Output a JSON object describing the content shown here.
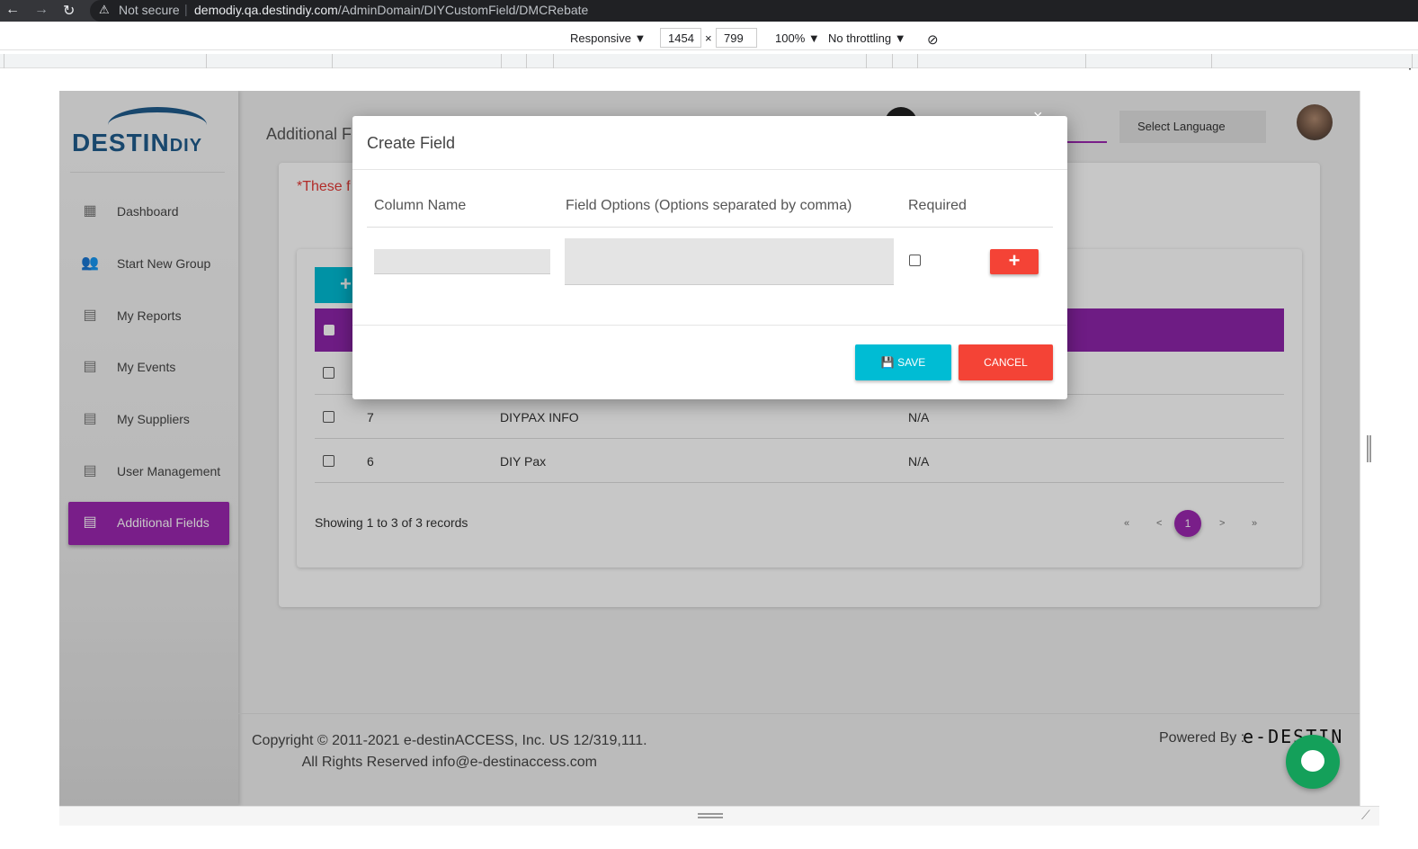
{
  "browser": {
    "not_secure": "Not secure",
    "url_host": "demodiy.qa.destindiy.com",
    "url_path": "/AdminDomain/DIYCustomField/DMCRebate"
  },
  "devtools": {
    "device": "Responsive",
    "width": "1454",
    "times": "×",
    "height": "799",
    "zoom": "100%",
    "throttling": "No throttling"
  },
  "sidebar": {
    "logo_main": "DESTIN",
    "logo_sub": "DIY",
    "items": [
      {
        "label": "Dashboard",
        "icon": "dashboard-icon"
      },
      {
        "label": "Start New Group",
        "icon": "people-icon"
      },
      {
        "label": "My Reports",
        "icon": "list-icon"
      },
      {
        "label": "My Events",
        "icon": "list-icon"
      },
      {
        "label": "My Suppliers",
        "icon": "list-icon"
      },
      {
        "label": "User Management",
        "icon": "list-icon"
      },
      {
        "label": "Additional Fields",
        "icon": "list-icon",
        "active": true
      }
    ]
  },
  "header": {
    "title": "Additional Fi",
    "select_clear": "×",
    "language": "Select Language"
  },
  "card": {
    "note": "*These f",
    "add_label": "+",
    "rows": [
      {
        "id": "",
        "name": "",
        "value": ""
      },
      {
        "id": "7",
        "name": "DIYPAX INFO",
        "value": "N/A"
      },
      {
        "id": "6",
        "name": "DIY Pax",
        "value": "N/A"
      }
    ],
    "showing": "Showing 1 to 3 of 3 records",
    "pager": {
      "first": "«",
      "prev": "<",
      "current": "1",
      "next": ">",
      "last": "»"
    }
  },
  "footer": {
    "copyright_line1": "Copyright © 2011-2021 e-destinACCESS, Inc. US 12/319,111.",
    "copyright_line2": "All Rights Reserved info@e-destinaccess.com",
    "powered_by": "Powered By :",
    "powered_logo": "e-DESTIN"
  },
  "modal": {
    "title": "Create Field",
    "close": "×",
    "col_name_header": "Column Name",
    "field_options_header": "Field Options (Options separated by comma)",
    "required_header": "Required",
    "col_name_value": "",
    "field_options_value": "",
    "add_row": "+",
    "save_label": "SAVE",
    "cancel_label": "CANCEL"
  },
  "colors": {
    "accent_purple": "#9c27b0",
    "cyan": "#00bcd4",
    "red": "#f44336",
    "brand_blue": "#1f5c8c"
  }
}
